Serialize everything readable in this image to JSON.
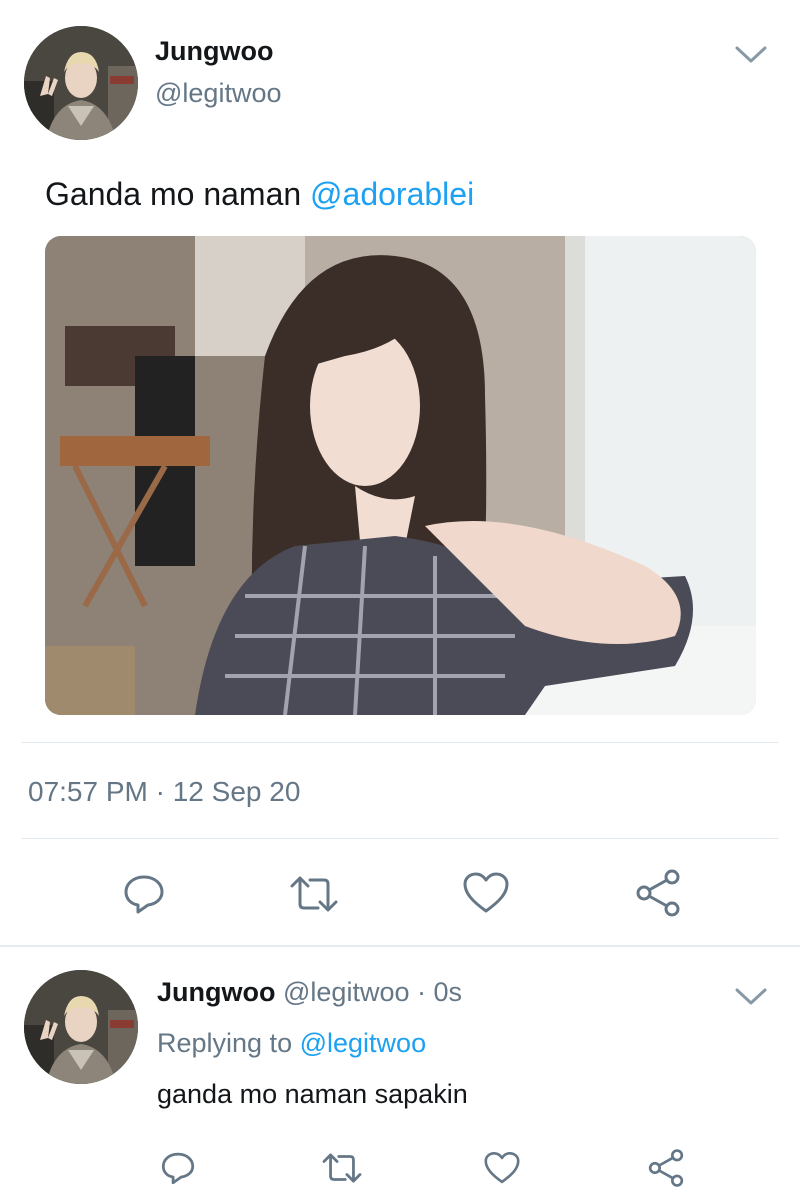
{
  "tweet": {
    "author_name": "Jungwoo",
    "author_handle": "@legitwoo",
    "text_prefix": "Ganda mo naman ",
    "mention": "@adorablei",
    "timestamp": "07:57 PM · 12 Sep 20"
  },
  "reply": {
    "author_name": "Jungwoo",
    "author_handle": "@legitwoo",
    "age": "· 0s",
    "replying_label": "Replying to",
    "replying_handle": "@legitwoo",
    "text": "ganda mo naman sapakin"
  },
  "actions": [
    "reply-icon",
    "retweet-icon",
    "like-icon",
    "share-icon"
  ],
  "colors": {
    "accent": "#1da1f2",
    "secondary_text": "#657786",
    "icon": "#657786",
    "divider": "#e1e8ed"
  }
}
